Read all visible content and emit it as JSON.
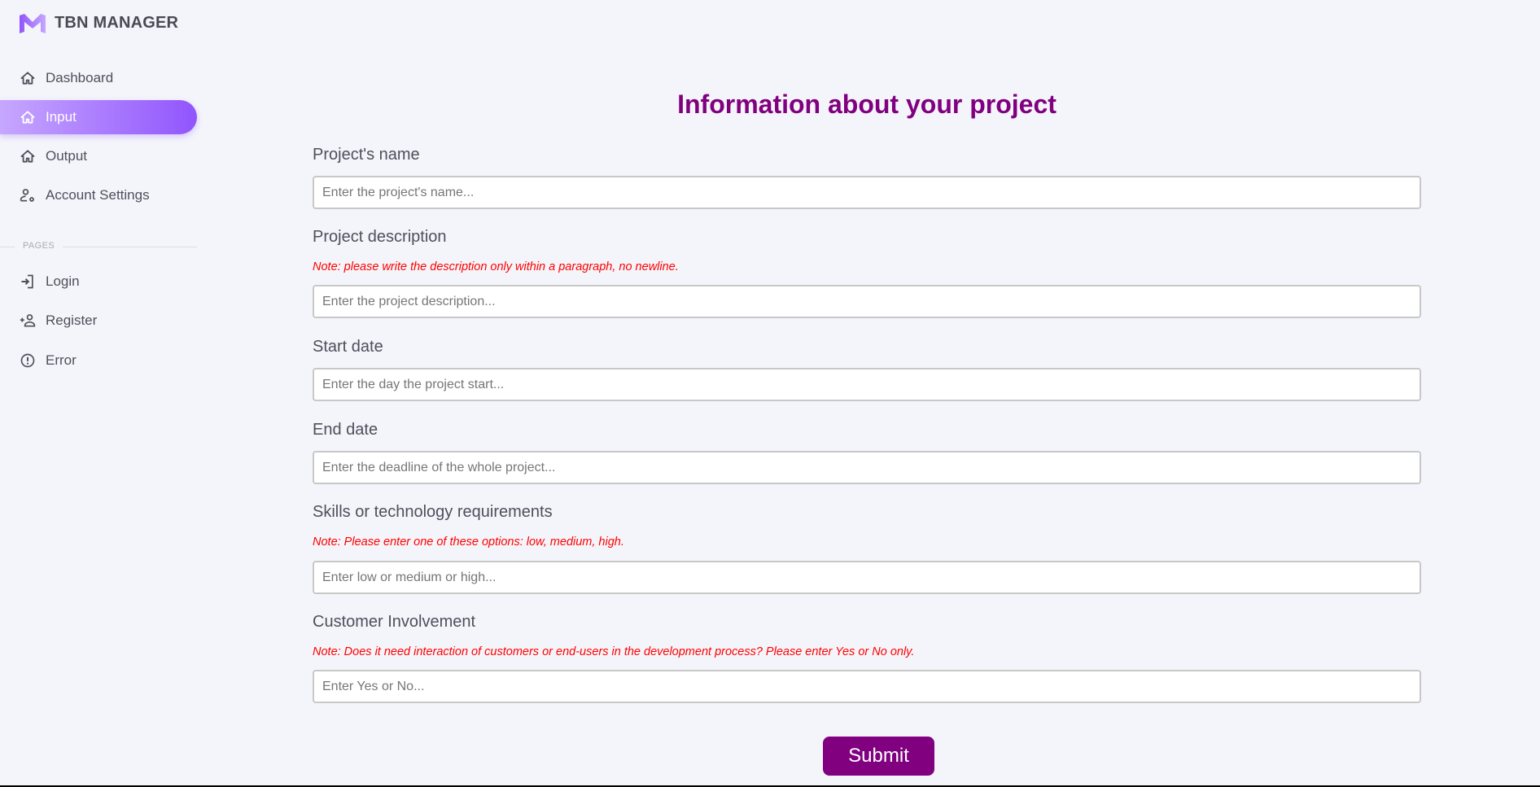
{
  "brand": {
    "name": "TBN MANAGER"
  },
  "sidebar": {
    "items": [
      {
        "label": "Dashboard",
        "icon": "home-icon"
      },
      {
        "label": "Input",
        "icon": "home-icon",
        "active": true
      },
      {
        "label": "Output",
        "icon": "home-icon"
      },
      {
        "label": "Account Settings",
        "icon": "account-cog-icon"
      }
    ],
    "section_label": "PAGES",
    "pages": [
      {
        "label": "Login",
        "icon": "login-icon"
      },
      {
        "label": "Register",
        "icon": "account-plus-icon"
      },
      {
        "label": "Error",
        "icon": "alert-circle-icon"
      }
    ]
  },
  "form": {
    "title": "Information about your project",
    "fields": [
      {
        "label": "Project's name",
        "placeholder": "Enter the project's name..."
      },
      {
        "label": "Project description",
        "note": "Note: please write the description only within a paragraph, no newline.",
        "placeholder": "Enter the project description..."
      },
      {
        "label": "Start date",
        "placeholder": "Enter the day the project start..."
      },
      {
        "label": "End date",
        "placeholder": "Enter the deadline of the whole project..."
      },
      {
        "label": "Skills or technology requirements",
        "note": "Note: Please enter one of these options: low, medium, high.",
        "placeholder": "Enter low or medium or high..."
      },
      {
        "label": "Customer Involvement",
        "note": "Note: Does it need interaction of customers or end-users in the development process? Please enter Yes or No only.",
        "placeholder": "Enter Yes or No..."
      }
    ],
    "submit_label": "Submit"
  },
  "colors": {
    "accent": "#9155fd",
    "title": "#800080",
    "note": "#ff0000",
    "background": "#f4f5fa"
  }
}
